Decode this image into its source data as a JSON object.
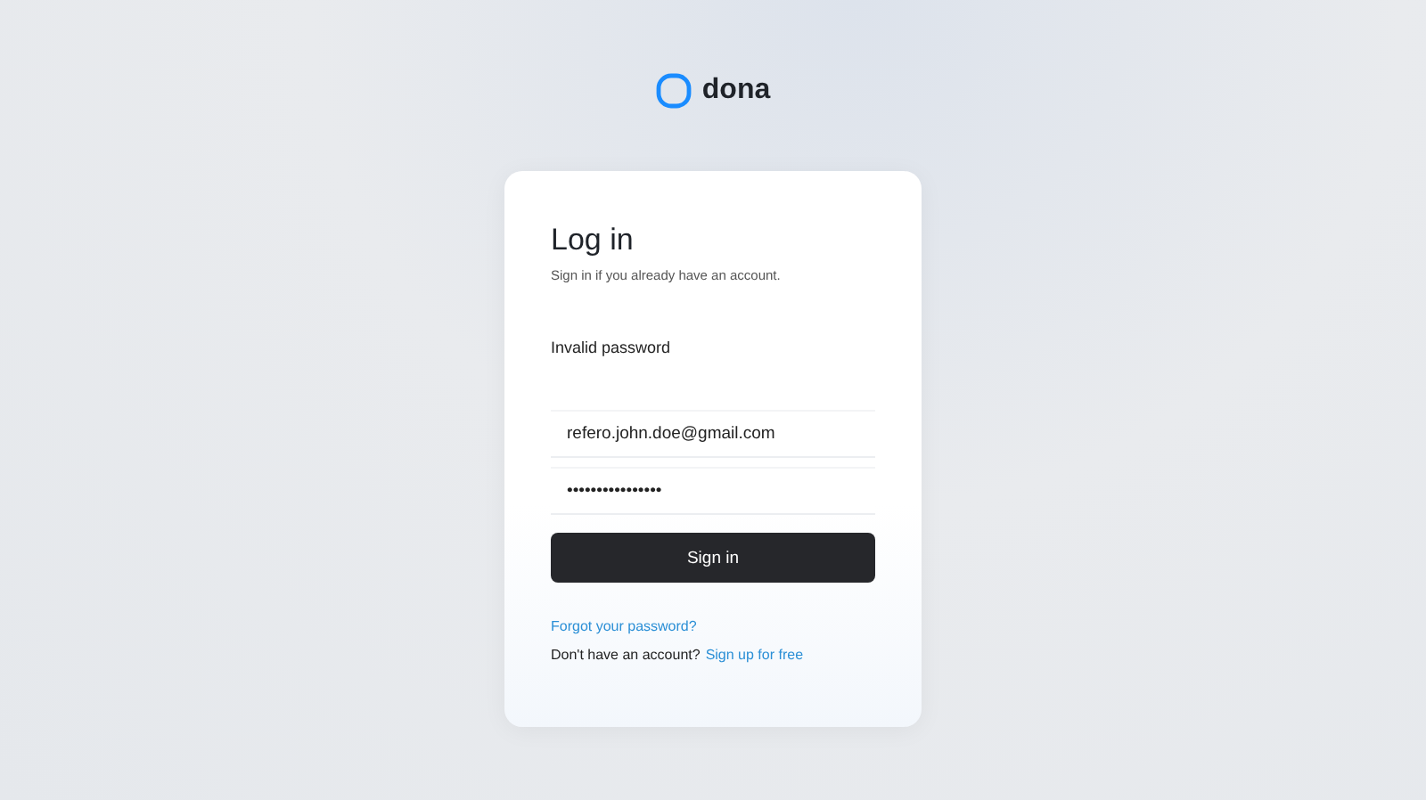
{
  "brand": {
    "name": "dona"
  },
  "card": {
    "title": "Log in",
    "subtitle": "Sign in if you already have an account.",
    "error": "Invalid password",
    "email": {
      "value": "refero.john.doe@gmail.com"
    },
    "password": {
      "value": "••••••••••••••••"
    },
    "submit": "Sign in",
    "forgot_link": "Forgot your password?",
    "signup_prompt": "Don't have an account?",
    "signup_link": "Sign up for free"
  }
}
